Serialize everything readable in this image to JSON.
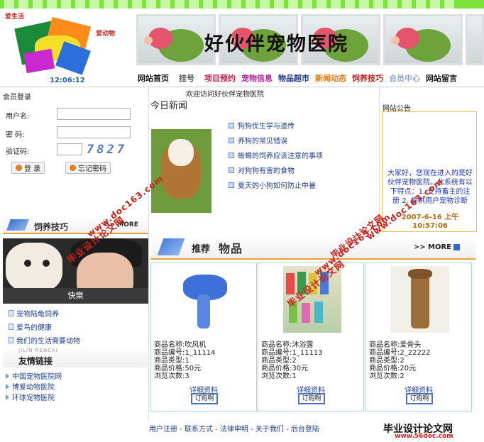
{
  "header": {
    "logo_text_top": "爱生活",
    "logo_text_side": "爱动物",
    "clock": "12:06:12",
    "site_title": "好伙伴宠物医院"
  },
  "nav": [
    {
      "label": "网站首页",
      "color": "#111111"
    },
    {
      "label": "挂号",
      "color": "#555555"
    },
    {
      "label": "项目预约",
      "color": "#c21d4a"
    },
    {
      "label": "宠物信息",
      "color": "#b3239b"
    },
    {
      "label": "物品超市",
      "color": "#1c2f8e"
    },
    {
      "label": "新闻动态",
      "color": "#e07c16"
    },
    {
      "label": "饲养技巧",
      "color": "#b82024"
    },
    {
      "label": "会员中心",
      "color": "#8fa7cf"
    },
    {
      "label": "网站留言",
      "color": "#111111"
    }
  ],
  "login": {
    "title": "会员登录",
    "username_label": "用户名:",
    "password_label": "密  码:",
    "captcha_label": "验证码:",
    "captcha_code": "7827",
    "login_button": "登 录",
    "forgot_button": "忘记密码"
  },
  "tips": {
    "title": "饲养技巧",
    "more": ">> MORE",
    "photo_caption": "快樂",
    "items": [
      "宠物陆龟饲养",
      "爱鸟的健康",
      "我们的生活需要动物"
    ]
  },
  "links": {
    "subtitle": "JILIN RENCAI",
    "title": "友情链接",
    "items": [
      "中国宠物医院网",
      "博爱动物医院",
      "环球宠物医院"
    ]
  },
  "news": {
    "welcome": "欢迎访问好伙伴宠物医院",
    "title": "今日新闻",
    "items": [
      "狗狗优生学与遗传",
      "养狗的常见错误",
      "蜥蜴的饲养应该注意的事项",
      "对狗狗有害的食物",
      "夏天的小狗如何防止中暑"
    ]
  },
  "notice": {
    "label": "网站公告",
    "text": "大家好，您现在进入的是好伙伴宠物医院。此系统有以下特点：1. 支持畜主的注册 2. 提供用户宠物诊断",
    "date": "2007-6-16 上午",
    "time": "10:57:06"
  },
  "recommend": {
    "title": "推荐",
    "title2": "物品",
    "more": ">> MORE",
    "products": [
      {
        "name": "商品名称:吹风机",
        "code": "商品编号:1_11114",
        "type": "商品类型:1",
        "price": "商品价格:50元",
        "views": "浏览次数:3",
        "detail": "详细资料",
        "buy": "订购啊"
      },
      {
        "name": "商品名称:沐浴露",
        "code": "商品编号:1_11113",
        "type": "商品类型:2",
        "price": "商品价格:30元",
        "views": "浏览次数:1",
        "detail": "详细资料",
        "buy": "订购啊"
      },
      {
        "name": "商品名称:爱骨头",
        "code": "商品编号:2_22222",
        "type": "商品类型:2",
        "price": "商品价格:20元",
        "views": "浏览次数:2",
        "detail": "详细资料",
        "buy": "订购啊"
      }
    ]
  },
  "footer": {
    "links": "用户注册 - 联系方式 - 法律申明 - 关于我们 - 后台登陆",
    "logo": "毕业设计论文网",
    "url": "www.56doc.com"
  },
  "watermarks": [
    "毕业设计论文网",
    "www.doc163.com",
    "毕业设计论文网",
    "www.doc163.com",
    "毕业设计论文网",
    "www.doc163.com"
  ]
}
